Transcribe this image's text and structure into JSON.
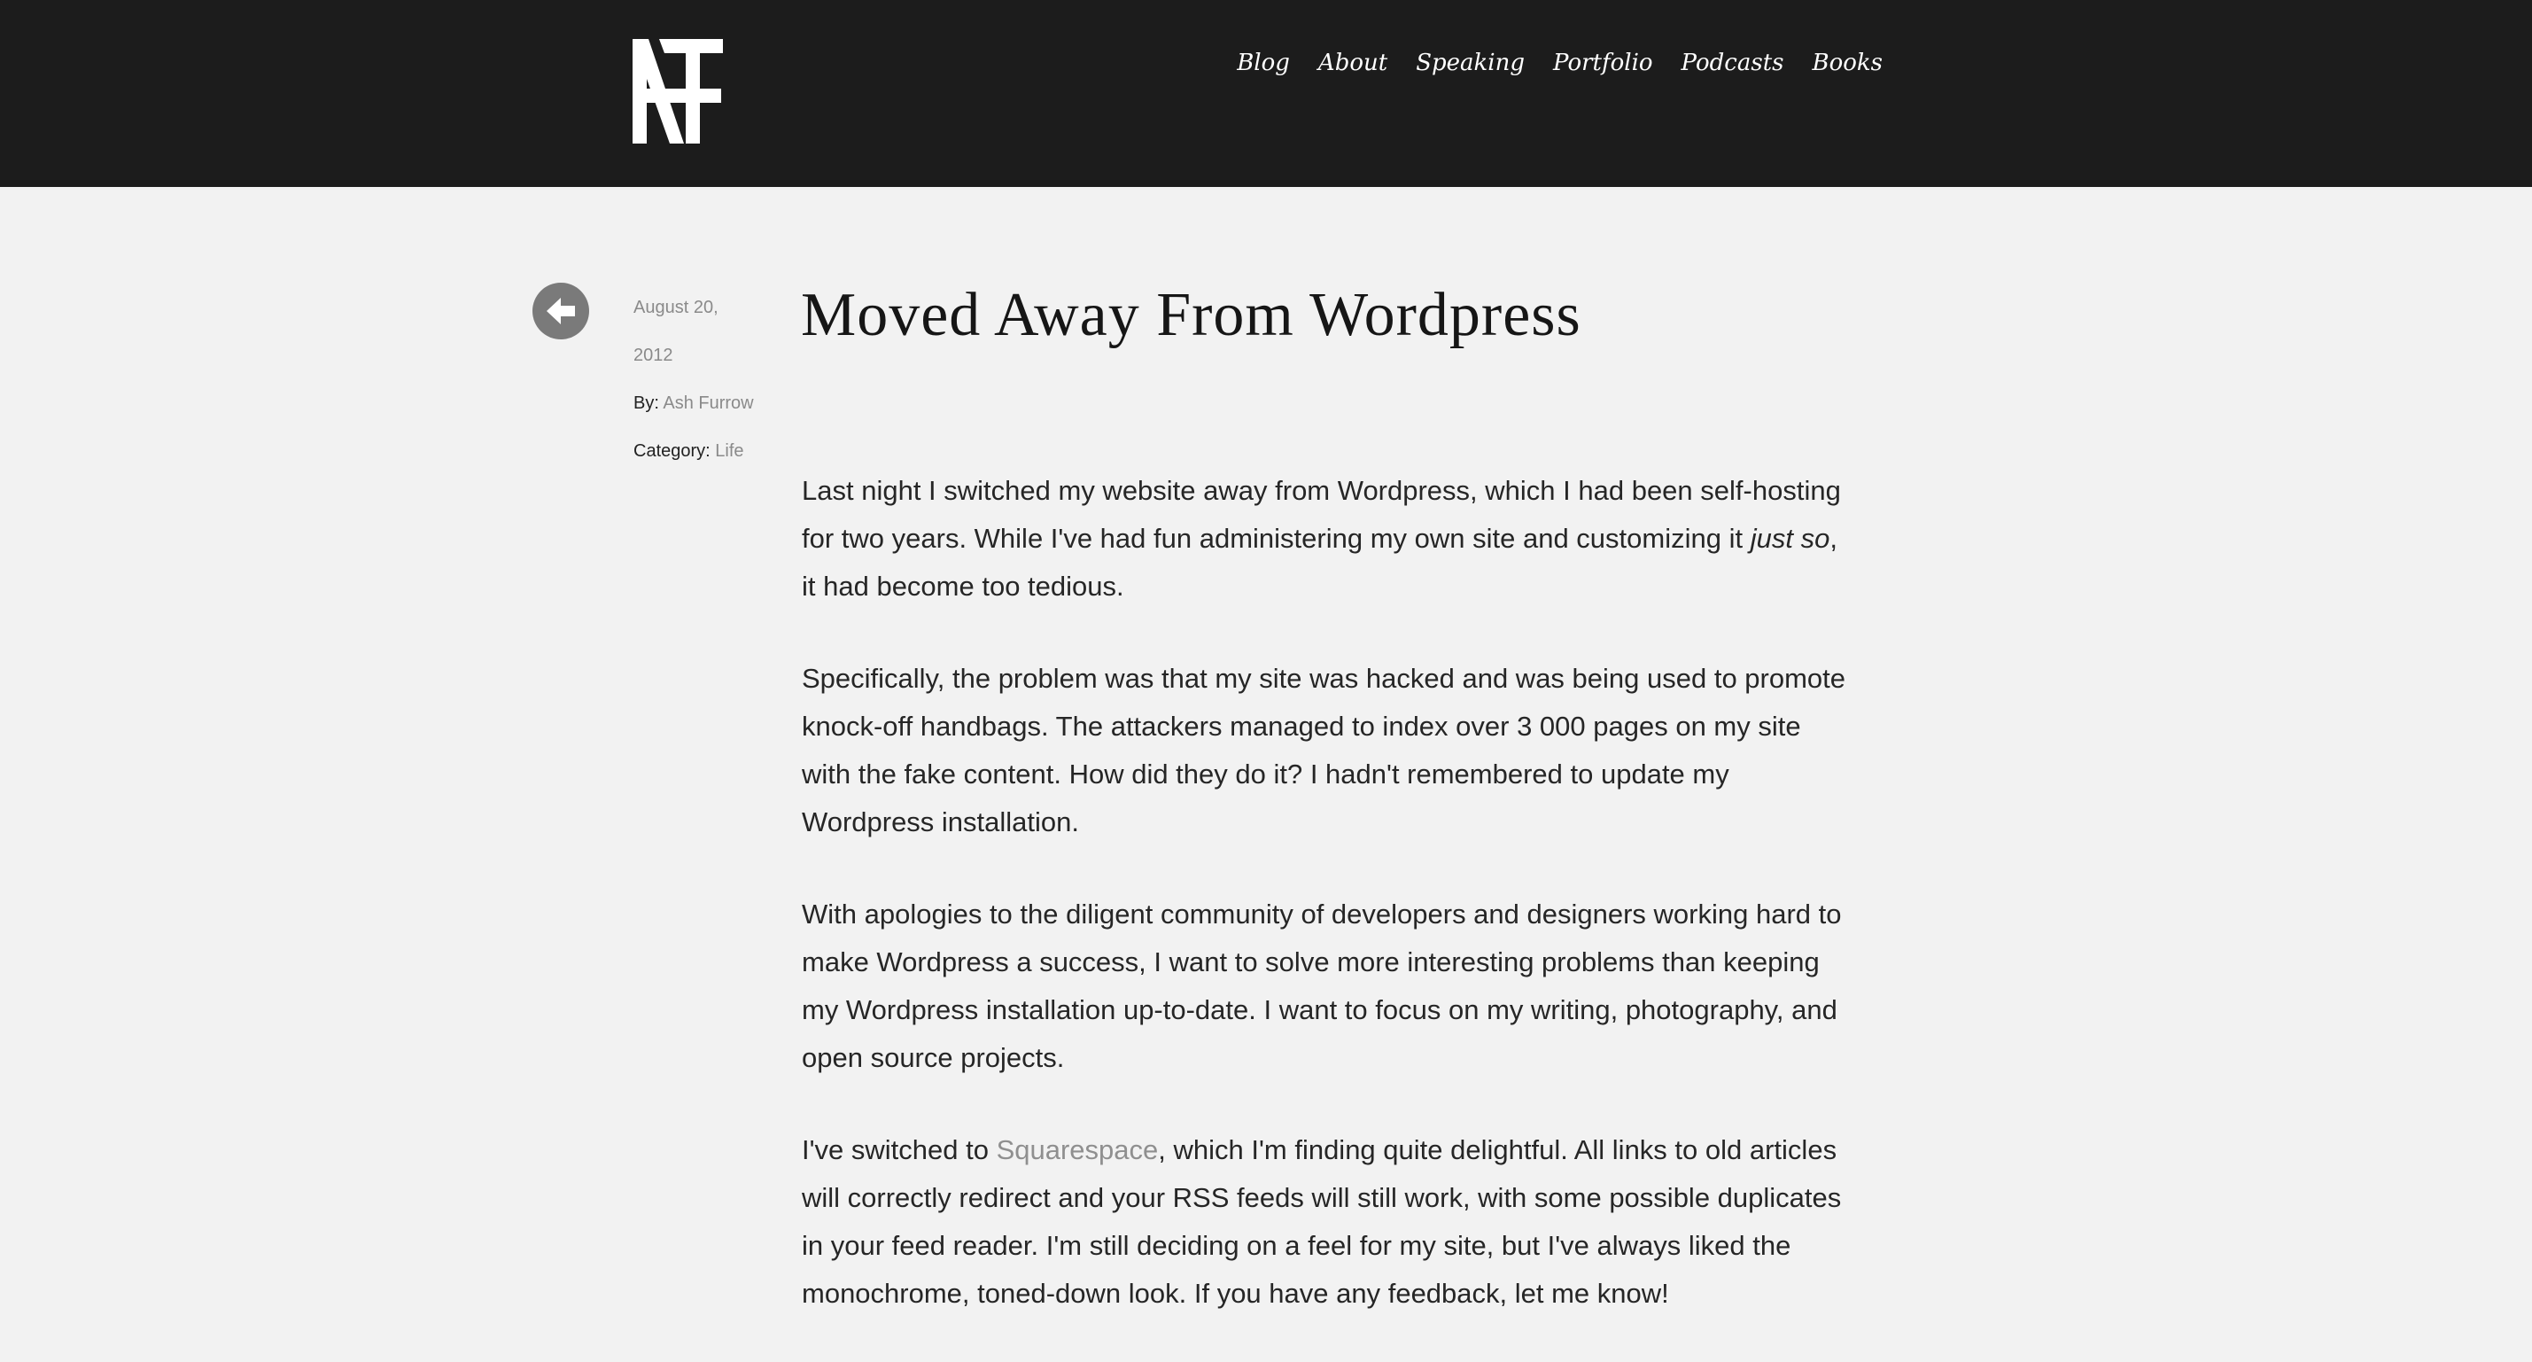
{
  "header": {
    "logo_icon": "af-monogram-logo",
    "nav": [
      "Blog",
      "About",
      "Speaking",
      "Portfolio",
      "Podcasts",
      "Books"
    ]
  },
  "sidebar": {
    "back_icon": "arrow-left-circle-icon",
    "date_line1": "August 20,",
    "date_line2": "2012",
    "by_label": "By:",
    "author": "Ash Furrow",
    "category_label": "Category:",
    "category": "Life"
  },
  "article": {
    "title": "Moved Away From Wordpress",
    "p1_before": "Last night I switched my website away from Wordpress, which I had been self-hosting for two years. While I've had fun administering my own site and customizing it ",
    "p1_em": "just so",
    "p1_after": ", it had become too tedious.",
    "p2": "Specifically, the problem was that my site was hacked and was being used to promote knock-off handbags. The attackers managed to index over 3 000 pages on my site with the fake content. How did they do it? I hadn't remembered to update my Wordpress installation.",
    "p3": "With apologies to the diligent community of developers and designers working hard to make Wordpress a success, I want to solve more interesting problems than keeping my Wordpress installation up-to-date. I want to focus on my writing, photography, and open source projects.",
    "p4_before": "I've switched to ",
    "p4_link": "Squarespace",
    "p4_after": ", which I'm finding quite delightful. All links to old articles will correctly redirect and your RSS feeds will still work, with some possible duplicates in your feed reader. I'm still deciding on a feel for my site, but I've always liked the monochrome, toned-down look. If you have any feedback, let me know!"
  },
  "colors": {
    "header_bg": "#1c1c1c",
    "page_bg": "#f2f2f2",
    "link": "#8f8f8f",
    "text": "#262626"
  }
}
